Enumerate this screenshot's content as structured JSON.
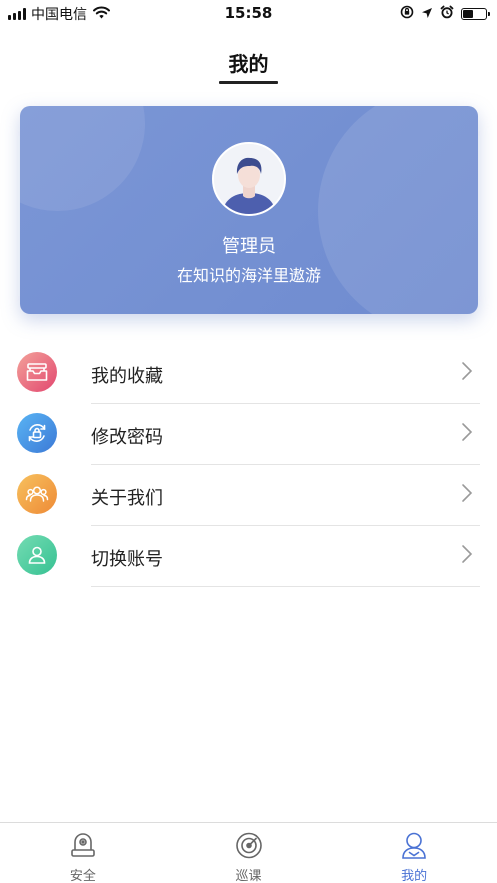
{
  "status_bar": {
    "carrier": "中国电信",
    "time": "15:58",
    "battery_level": 0.45
  },
  "header": {
    "title": "我的"
  },
  "profile": {
    "name": "管理员",
    "motto": "在知识的海洋里遨游",
    "avatar_icon": "user-avatar-icon"
  },
  "menu": {
    "items": [
      {
        "label": "我的收藏",
        "icon": "inbox-tray-icon",
        "gradient": [
          "#f3a29a",
          "#e2476f"
        ]
      },
      {
        "label": "修改密码",
        "icon": "lock-refresh-icon",
        "gradient": [
          "#59b4f4",
          "#3c79d6"
        ]
      },
      {
        "label": "关于我们",
        "icon": "users-icon",
        "gradient": [
          "#f7c15e",
          "#ee8a36"
        ]
      },
      {
        "label": "切换账号",
        "icon": "user-switch-icon",
        "gradient": [
          "#74dcb3",
          "#36c192"
        ]
      }
    ]
  },
  "tab_bar": {
    "tabs": [
      {
        "label": "安全",
        "icon": "camera-icon",
        "active": false
      },
      {
        "label": "巡课",
        "icon": "radar-icon",
        "active": false
      },
      {
        "label": "我的",
        "icon": "person-icon",
        "active": true
      }
    ]
  },
  "colors": {
    "accent": "#4a72d4",
    "card": "#7490d2"
  }
}
